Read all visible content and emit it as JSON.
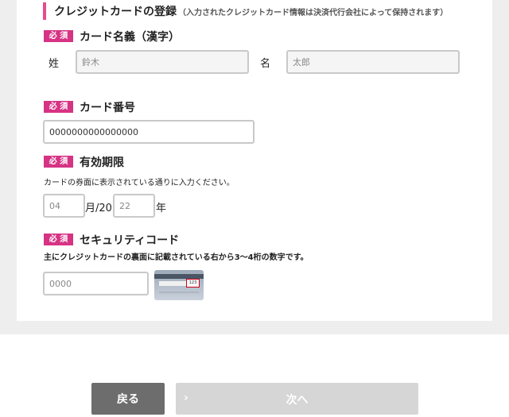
{
  "section": {
    "title": "クレジットカードの登録",
    "note": "（入力されたクレジットカード情報は決済代行会社によって保持されます）"
  },
  "required_badge": "必 須",
  "name": {
    "label": "カード名義（漢字）",
    "last_label": "姓",
    "last_placeholder": "鈴木",
    "first_label": "名",
    "first_placeholder": "太郎"
  },
  "number": {
    "label": "カード番号",
    "value": "0000000000000000"
  },
  "expiry": {
    "label": "有効期限",
    "hint": "カードの券面に表示されている通りに入力ください。",
    "month_placeholder": "04",
    "month_suffix": "月/20",
    "year_placeholder": "22",
    "year_suffix": "年"
  },
  "security": {
    "label": "セキュリティコード",
    "hint": "主にクレジットカードの裏面に記載されている右から3〜4桁の数字です。",
    "placeholder": "0000",
    "card_cvv": "123"
  },
  "buttons": {
    "back": "戻る",
    "next": "次へ",
    "next_icon": "›"
  }
}
